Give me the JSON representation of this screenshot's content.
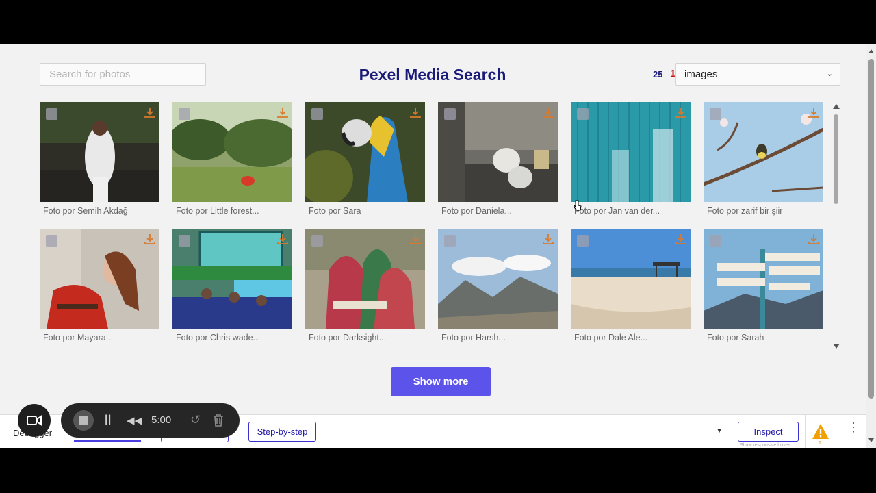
{
  "header": {
    "search_placeholder": "Search for photos",
    "title": "Pexel Media Search",
    "result_count": "25",
    "page_number": "1",
    "media_type": "images"
  },
  "photos": [
    {
      "caption": "Foto por Semih Akdağ"
    },
    {
      "caption": "Foto por Little forest..."
    },
    {
      "caption": "Foto por Sara"
    },
    {
      "caption": "Foto por Daniela..."
    },
    {
      "caption": "Foto por Jan van der..."
    },
    {
      "caption": "Foto por zarif bir şiir"
    },
    {
      "caption": "Foto por Mayara..."
    },
    {
      "caption": "Foto por Chris wade..."
    },
    {
      "caption": "Foto por Darksight..."
    },
    {
      "caption": "Foto por Harsh..."
    },
    {
      "caption": "Foto por Dale Ale..."
    },
    {
      "caption": "Foto por Sarah"
    }
  ],
  "show_more_label": "Show more",
  "debugger": {
    "label": "Debugger",
    "step_button": "Step-by-step",
    "inspect_button": "Inspect",
    "inspect_hint": "Show responsive boxes",
    "warning_count": "1"
  },
  "recorder": {
    "time": "5:00"
  },
  "colors": {
    "accent": "#5b53ea",
    "title": "#1a1a78",
    "page_number": "#d01818",
    "background": "#f2f2f2"
  }
}
